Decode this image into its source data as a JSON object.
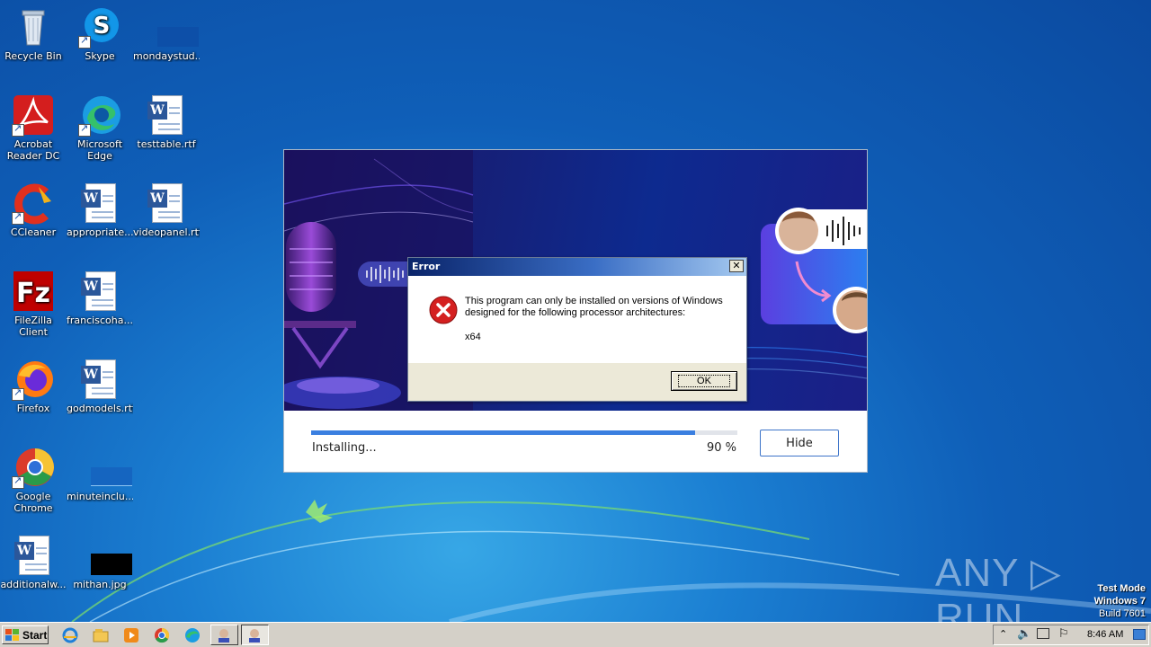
{
  "desktop": {
    "icons": [
      {
        "label": "Recycle Bin",
        "icon": "recycle-bin-icon"
      },
      {
        "label": "Skype",
        "icon": "skype-icon"
      },
      {
        "label": "mondaystud...",
        "icon": "blank-file-icon"
      },
      {
        "label": "Acrobat Reader DC",
        "icon": "acrobat-icon"
      },
      {
        "label": "Microsoft Edge",
        "icon": "edge-icon"
      },
      {
        "label": "testtable.rtf",
        "icon": "word-doc-icon"
      },
      {
        "label": "CCleaner",
        "icon": "ccleaner-icon"
      },
      {
        "label": "appropriate...",
        "icon": "word-doc-icon"
      },
      {
        "label": "videopanel.rtf",
        "icon": "word-doc-icon"
      },
      {
        "label": "FileZilla Client",
        "icon": "filezilla-icon"
      },
      {
        "label": "franciscoha...",
        "icon": "word-doc-icon"
      },
      {
        "label": "Firefox",
        "icon": "firefox-icon"
      },
      {
        "label": "godmodels.rtf",
        "icon": "word-doc-icon"
      },
      {
        "label": "Google Chrome",
        "icon": "chrome-icon"
      },
      {
        "label": "minuteinclu...",
        "icon": "blank-file-icon"
      },
      {
        "label": "additionalw...",
        "icon": "word-doc-icon"
      },
      {
        "label": "mithan.jpg",
        "icon": "image-file-icon"
      }
    ]
  },
  "installer": {
    "status_label": "Installing...",
    "progress": 0.9,
    "progress_text": "90 %",
    "hide_label": "Hide"
  },
  "error_dialog": {
    "title": "Error",
    "close_glyph": "✕",
    "message": "This program can only be installed on versions of Windows designed for the following processor architectures:",
    "architecture": "x64",
    "ok_label": "OK"
  },
  "taskbar": {
    "start_label": "Start",
    "clock": "8:46 AM"
  },
  "watermark": {
    "brand": "ANY ▷ RUN",
    "test_mode": "Test Mode",
    "os": "Windows 7",
    "build": "Build 7601"
  },
  "colors": {
    "wallpaper": "#1b7fd2",
    "progress_fill": "#3a7fe0",
    "error_red": "#d42020"
  }
}
